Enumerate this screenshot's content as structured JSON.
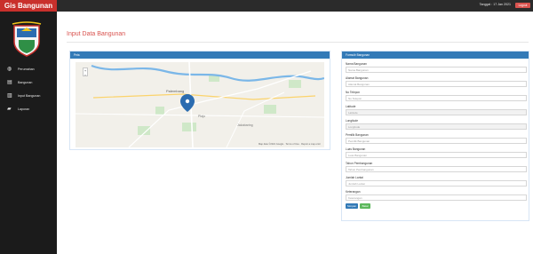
{
  "app": {
    "brand": "Gis Bangunan"
  },
  "topbar": {
    "date_text": "Tanggal : 17 Jan 2021",
    "logout_label": "Logout"
  },
  "sidebar": {
    "items": [
      {
        "label": "Perumahan",
        "icon": "globe-icon"
      },
      {
        "label": "Bangunan",
        "icon": "building-icon"
      },
      {
        "label": "Input Bangunan",
        "icon": "chart-icon"
      },
      {
        "label": "Laporan",
        "icon": "folder-icon"
      }
    ]
  },
  "page": {
    "title": "Input Data Bangunan"
  },
  "map_panel": {
    "title": "Peta",
    "zoom_in": "+",
    "zoom_out": "−",
    "attribution": "Map data ©2021 Google · Terms of Use · Report a map error"
  },
  "form_panel": {
    "title": "Formulir Bangunan",
    "fields": [
      {
        "label": "Nama Bangunan",
        "placeholder": "Nama Bangunan"
      },
      {
        "label": "Alamat Bangunan",
        "placeholder": "Alamat Bangunan"
      },
      {
        "label": "No Telepon",
        "placeholder": "No Telepon"
      },
      {
        "label": "Latitude",
        "placeholder": "Latitude"
      },
      {
        "label": "Longitude",
        "placeholder": "Longitude"
      },
      {
        "label": "Pemilik Bangunan",
        "placeholder": "Pemilik Bangunan"
      },
      {
        "label": "Luas Bangunan",
        "placeholder": "Luas Bangunan"
      },
      {
        "label": "Tahun Pembangunan",
        "placeholder": "Tahun Pembangunan"
      },
      {
        "label": "Jumlah Lantai",
        "placeholder": "Jumlah Lantai"
      },
      {
        "label": "Keterangan",
        "placeholder": "Keterangan"
      }
    ],
    "buttons": {
      "save": "Simpan",
      "cancel": "Batal"
    }
  },
  "colors": {
    "brand_red": "#c9302c",
    "panel_blue": "#337ab7",
    "success_green": "#5cb85c"
  }
}
